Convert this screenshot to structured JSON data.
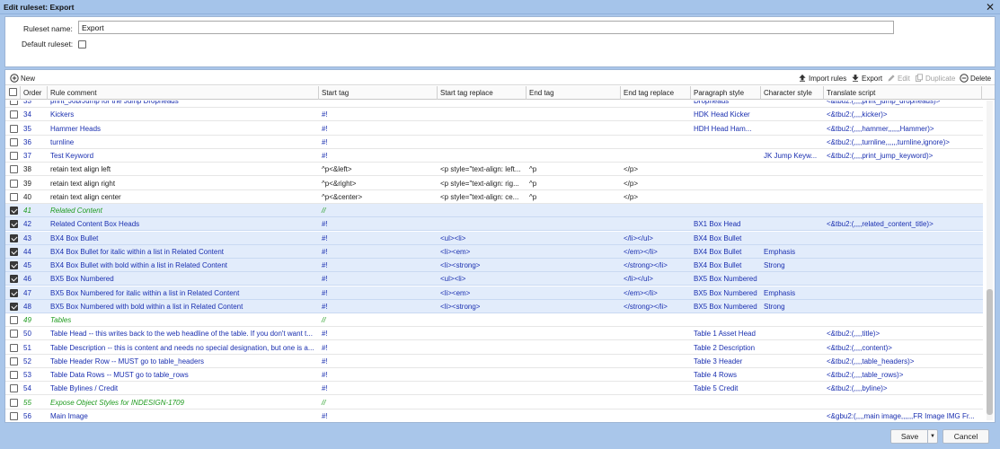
{
  "window": {
    "title": "Edit ruleset: Export"
  },
  "form": {
    "name_label": "Ruleset name:",
    "name_value": "Export",
    "default_label": "Default ruleset:"
  },
  "toolbar": {
    "new_label": "New",
    "import_label": "Import rules",
    "export_label": "Export",
    "edit_label": "Edit",
    "duplicate_label": "Duplicate",
    "delete_label": "Delete"
  },
  "columns": [
    "Order",
    "Rule comment",
    "Start tag",
    "Start tag replace",
    "End tag",
    "End tag replace",
    "Paragraph style",
    "Character style",
    "Translate script"
  ],
  "rows": [
    {
      "order": "33",
      "comment": "print_Job/Jump for the Jump Dropheads",
      "start": "",
      "start_replace": "",
      "end": "",
      "end_replace": "",
      "para": "Dropheads",
      "char": "",
      "script": "<&tbu2:(,,,,print_jump_dropheads)>",
      "checked": false,
      "kind": "regular"
    },
    {
      "order": "34",
      "comment": "Kickers",
      "start": "#!",
      "start_replace": "",
      "end": "",
      "end_replace": "",
      "para": "HDK Head Kicker",
      "char": "",
      "script": "<&tbu2:(,,,,kicker)>",
      "checked": false,
      "kind": "regular"
    },
    {
      "order": "35",
      "comment": "Hammer Heads",
      "start": "#!",
      "start_replace": "",
      "end": "",
      "end_replace": "",
      "para": "HDH Head Ham...",
      "char": "",
      "script": "<&tbu2:(,,,,hammer,,,,,,Hammer)>",
      "checked": false,
      "kind": "regular"
    },
    {
      "order": "36",
      "comment": "turnline",
      "start": "#!",
      "start_replace": "",
      "end": "",
      "end_replace": "",
      "para": "",
      "char": "",
      "script": "<&tbu2:(,,,,turnline,,,,,,turnline,ignore)>",
      "checked": false,
      "kind": "regular"
    },
    {
      "order": "37",
      "comment": "Test Keyword",
      "start": "#!",
      "start_replace": "",
      "end": "",
      "end_replace": "",
      "para": "",
      "char": "JK Jump Keyw...",
      "script": "<&tbu2:(,,,,print_jump_keyword)>",
      "checked": false,
      "kind": "regular"
    },
    {
      "order": "38",
      "comment": "retain text align left",
      "start": "^p<&left>",
      "start_replace": "<p style=\"text-align: left...",
      "end": "^p",
      "end_replace": "</p>",
      "para": "",
      "char": "",
      "script": "",
      "checked": false,
      "kind": "plain"
    },
    {
      "order": "39",
      "comment": "retain text align right",
      "start": "^p<&right>",
      "start_replace": "<p style=\"text-align: rig...",
      "end": "^p",
      "end_replace": "</p>",
      "para": "",
      "char": "",
      "script": "",
      "checked": false,
      "kind": "plain"
    },
    {
      "order": "40",
      "comment": "retain text align center",
      "start": "^p<&center>",
      "start_replace": "<p style=\"text-align: ce...",
      "end": "^p",
      "end_replace": "</p>",
      "para": "",
      "char": "",
      "script": "",
      "checked": false,
      "kind": "plain"
    },
    {
      "order": "41",
      "comment": "Related Content",
      "start": "//",
      "start_replace": "",
      "end": "",
      "end_replace": "",
      "para": "",
      "char": "",
      "script": "",
      "checked": true,
      "kind": "comment"
    },
    {
      "order": "42",
      "comment": "Related Content Box Heads",
      "start": "#!",
      "start_replace": "",
      "end": "",
      "end_replace": "",
      "para": "BX1 Box Head",
      "char": "",
      "script": "<&tbu2:(,,,,related_content_title)>",
      "checked": true,
      "kind": "regular"
    },
    {
      "order": "43",
      "comment": "BX4 Box Bullet",
      "start": "#!",
      "start_replace": "<ul><li>",
      "end": "",
      "end_replace": "</li></ul>",
      "para": "BX4 Box Bullet",
      "char": "",
      "script": "",
      "checked": true,
      "kind": "regular"
    },
    {
      "order": "44",
      "comment": "BX4 Box Bullet for italic within a list in Related Content",
      "start": "#!",
      "start_replace": "<li><em>",
      "end": "",
      "end_replace": "</em></li>",
      "para": "BX4 Box Bullet",
      "char": "Emphasis",
      "script": "",
      "checked": true,
      "kind": "regular"
    },
    {
      "order": "45",
      "comment": "BX4 Box Bullet with bold within a list in Related Content",
      "start": "#!",
      "start_replace": "<li><strong>",
      "end": "",
      "end_replace": "</strong></li>",
      "para": "BX4 Box Bullet",
      "char": "Strong",
      "script": "",
      "checked": true,
      "kind": "regular"
    },
    {
      "order": "46",
      "comment": "BX5 Box Numbered",
      "start": "#!",
      "start_replace": "<ul><li>",
      "end": "",
      "end_replace": "</li></ul>",
      "para": "BX5 Box Numbered",
      "char": "",
      "script": "",
      "checked": true,
      "kind": "regular"
    },
    {
      "order": "47",
      "comment": "BX5 Box Numbered for italic within a list in Related Content",
      "start": "#!",
      "start_replace": "<li><em>",
      "end": "",
      "end_replace": "</em></li>",
      "para": "BX5 Box Numbered",
      "char": "Emphasis",
      "script": "",
      "checked": true,
      "kind": "regular"
    },
    {
      "order": "48",
      "comment": "BX5 Box Numbered with bold within a list in Related Content",
      "start": "#!",
      "start_replace": "<li><strong>",
      "end": "",
      "end_replace": "</strong></li>",
      "para": "BX5 Box Numbered",
      "char": "Strong",
      "script": "",
      "checked": true,
      "kind": "regular"
    },
    {
      "order": "49",
      "comment": "Tables",
      "start": "//",
      "start_replace": "",
      "end": "",
      "end_replace": "",
      "para": "",
      "char": "",
      "script": "",
      "checked": false,
      "kind": "comment"
    },
    {
      "order": "50",
      "comment": "Table Head -- this writes back to the web headline of the table. If you don't want t...",
      "start": "#!",
      "start_replace": "",
      "end": "",
      "end_replace": "",
      "para": "Table 1 Asset Head",
      "char": "",
      "script": "<&tbu2:(,,,,title)>",
      "checked": false,
      "kind": "regular"
    },
    {
      "order": "51",
      "comment": "Table Description -- this is content and needs no special designation, but one is a...",
      "start": "#!",
      "start_replace": "",
      "end": "",
      "end_replace": "",
      "para": "Table 2 Description",
      "char": "",
      "script": "<&tbu2:(,,,,content)>",
      "checked": false,
      "kind": "regular"
    },
    {
      "order": "52",
      "comment": "Table Header Row -- MUST go to table_headers",
      "start": "#!",
      "start_replace": "",
      "end": "",
      "end_replace": "",
      "para": "Table 3 Header",
      "char": "",
      "script": "<&tbu2:(,,,,table_headers)>",
      "checked": false,
      "kind": "regular"
    },
    {
      "order": "53",
      "comment": "Table Data Rows -- MUST go to table_rows",
      "start": "#!",
      "start_replace": "",
      "end": "",
      "end_replace": "",
      "para": "Table 4 Rows",
      "char": "",
      "script": "<&tbu2:(,,,,table_rows)>",
      "checked": false,
      "kind": "regular"
    },
    {
      "order": "54",
      "comment": "Table Bylines / Credit",
      "start": "#!",
      "start_replace": "",
      "end": "",
      "end_replace": "",
      "para": "Table 5 Credit",
      "char": "",
      "script": "<&tbu2:(,,,,byline)>",
      "checked": false,
      "kind": "regular"
    },
    {
      "order": "55",
      "comment": "Expose Object Styles for INDESIGN-1709",
      "start": "//",
      "start_replace": "",
      "end": "",
      "end_replace": "",
      "para": "",
      "char": "",
      "script": "",
      "checked": false,
      "kind": "comment"
    },
    {
      "order": "56",
      "comment": "Main Image",
      "start": "#!",
      "start_replace": "",
      "end": "",
      "end_replace": "",
      "para": "",
      "char": "",
      "script": "<&gbu2:(,,,,main image,,,,,,FR Image IMG Fr...",
      "checked": false,
      "kind": "regular"
    }
  ],
  "footer": {
    "save_label": "Save",
    "cancel_label": "Cancel"
  }
}
